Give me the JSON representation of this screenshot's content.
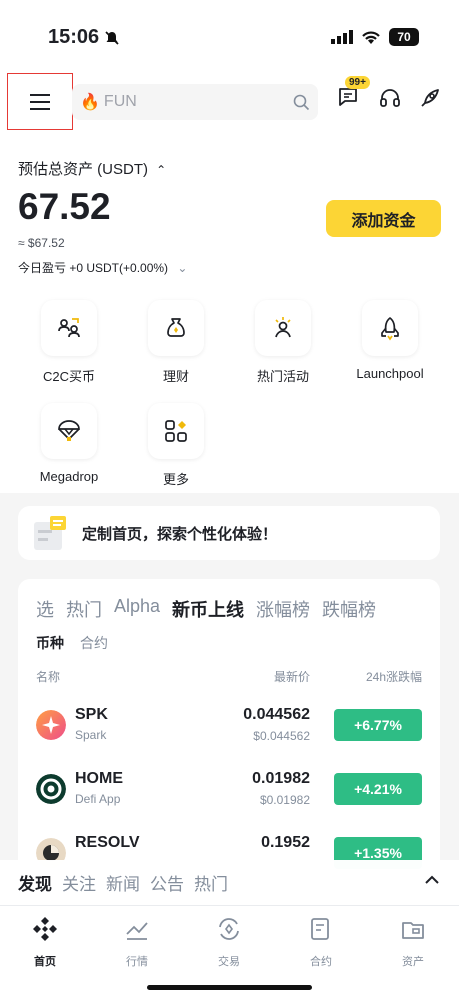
{
  "status_bar": {
    "time": "15:06",
    "battery": "70"
  },
  "header": {
    "search_placeholder": "FUN",
    "message_badge": "99+",
    "icons": [
      "menu-icon",
      "search-icon",
      "message-icon",
      "headset-icon",
      "rocket-icon"
    ]
  },
  "assets": {
    "label": "预估总资产 (USDT)",
    "balance": "67.52",
    "approx": "≈ $67.52",
    "pnl": "今日盈亏 +0 USDT(+0.00%)",
    "add_funds": "添加资金"
  },
  "shortcuts": [
    {
      "label": "C2C买币",
      "icon": "c2c-icon"
    },
    {
      "label": "理财",
      "icon": "earn-icon"
    },
    {
      "label": "热门活动",
      "icon": "activity-icon"
    },
    {
      "label": "Launchpool",
      "icon": "launchpool-icon"
    },
    {
      "label": "Megadrop",
      "icon": "megadrop-icon"
    },
    {
      "label": "更多",
      "icon": "more-icon"
    }
  ],
  "customize": {
    "text": "定制首页，探索个性化体验！"
  },
  "market": {
    "tabs": [
      "选",
      "热门",
      "Alpha",
      "新币上线",
      "涨幅榜",
      "跌幅榜"
    ],
    "active_tab": 3,
    "subtabs": [
      "币种",
      "合约"
    ],
    "headers": {
      "name": "名称",
      "price": "最新价",
      "change": "24h涨跌幅"
    },
    "rows": [
      {
        "symbol": "SPK",
        "name": "Spark",
        "price": "0.044562",
        "price_usd": "$0.044562",
        "change": "+6.77%"
      },
      {
        "symbol": "HOME",
        "name": "Defi App",
        "price": "0.01982",
        "price_usd": "$0.01982",
        "change": "+4.21%"
      },
      {
        "symbol": "RESOLV",
        "name": "",
        "price": "0.1952",
        "price_usd": "",
        "change": "+1.35%"
      }
    ]
  },
  "news": {
    "tabs": [
      "发现",
      "关注",
      "新闻",
      "公告",
      "热门"
    ]
  },
  "bottom_nav": [
    {
      "label": "首页",
      "icon": "home-icon"
    },
    {
      "label": "行情",
      "icon": "markets-icon"
    },
    {
      "label": "交易",
      "icon": "trade-icon"
    },
    {
      "label": "合约",
      "icon": "futures-icon"
    },
    {
      "label": "资产",
      "icon": "wallet-icon"
    }
  ],
  "colors": {
    "accent": "#fcd535",
    "up": "#2ebd85",
    "text": "#1e2026",
    "muted": "#848e9c"
  }
}
